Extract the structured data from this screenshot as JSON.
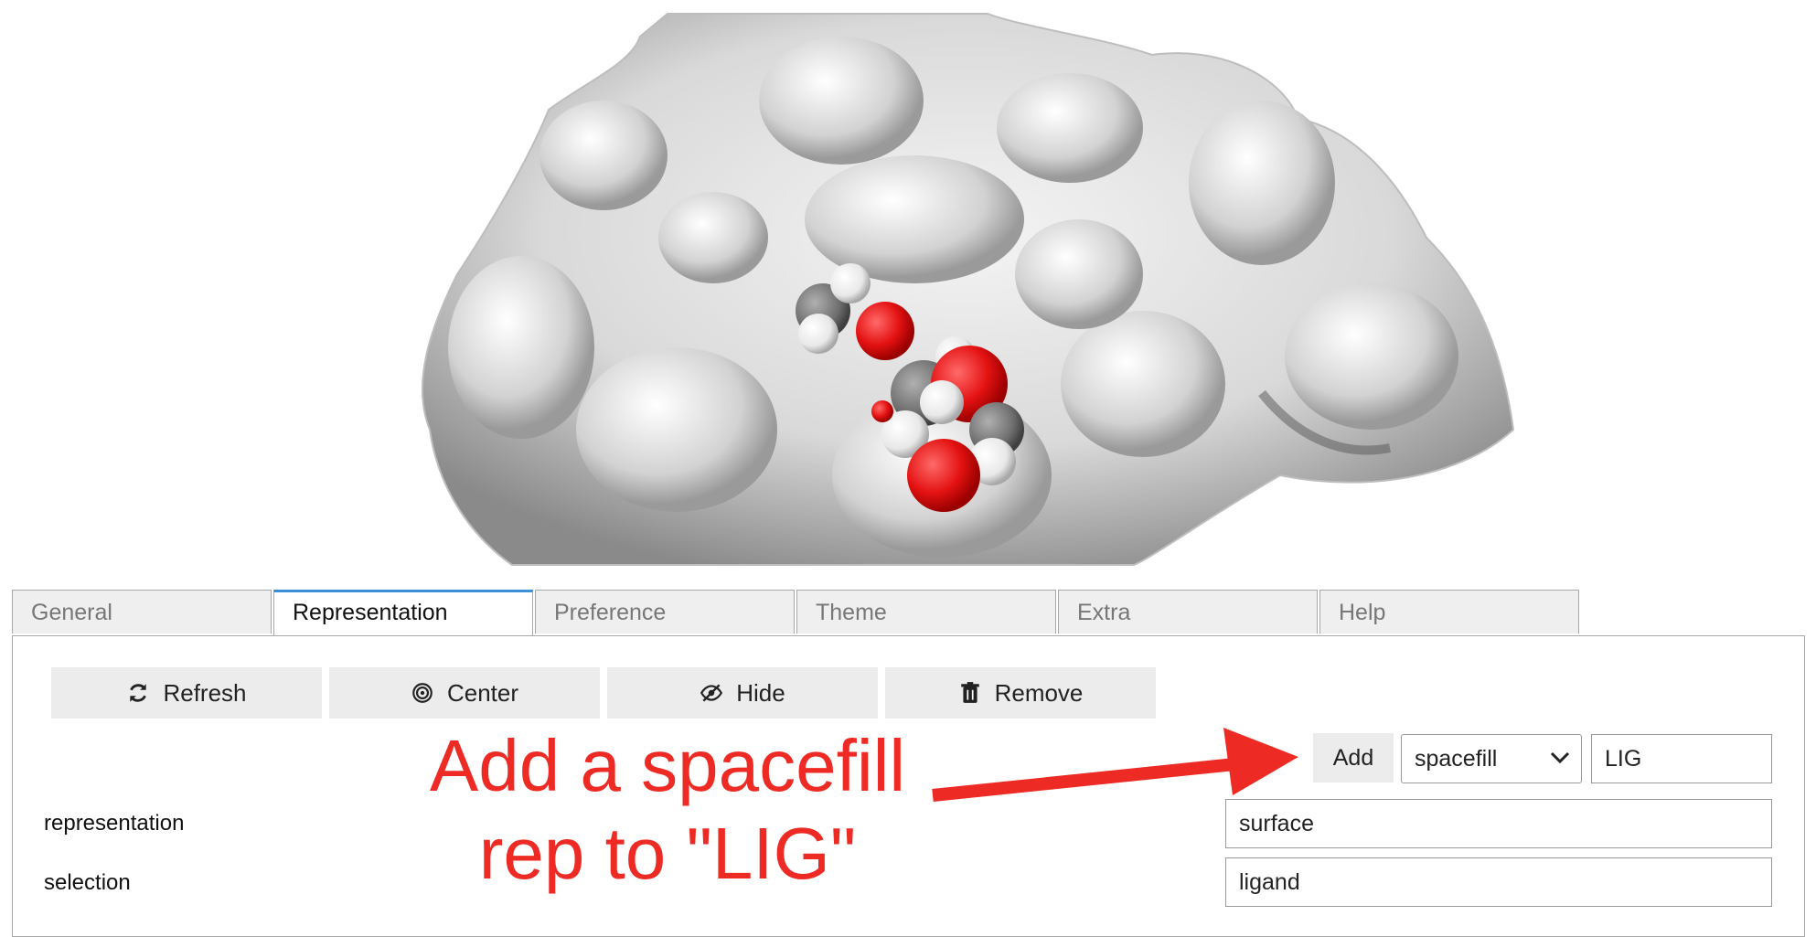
{
  "tabs": [
    {
      "label": "General"
    },
    {
      "label": "Representation"
    },
    {
      "label": "Preference"
    },
    {
      "label": "Theme"
    },
    {
      "label": "Extra"
    },
    {
      "label": "Help"
    }
  ],
  "active_tab": "Representation",
  "toolbar": {
    "refresh_label": "Refresh",
    "center_label": "Center",
    "hide_label": "Hide",
    "remove_label": "Remove"
  },
  "add_rep": {
    "add_label": "Add",
    "type_selected": "spacefill",
    "selection_value": "LIG"
  },
  "fields": {
    "representation_label": "representation",
    "representation_value": "surface",
    "selection_label": "selection",
    "selection_value": "ligand"
  },
  "annotation": {
    "line1": "Add a spacefill",
    "line2": "rep to \"LIG\"",
    "color": "#ee2a24"
  },
  "colors": {
    "accent": "#3b8fd9",
    "tab_bg": "#efefef",
    "button_bg": "#ececec",
    "oxygen": "#e41212",
    "carbon": "#7a7a7a",
    "hydrogen": "#f2f2f2"
  }
}
